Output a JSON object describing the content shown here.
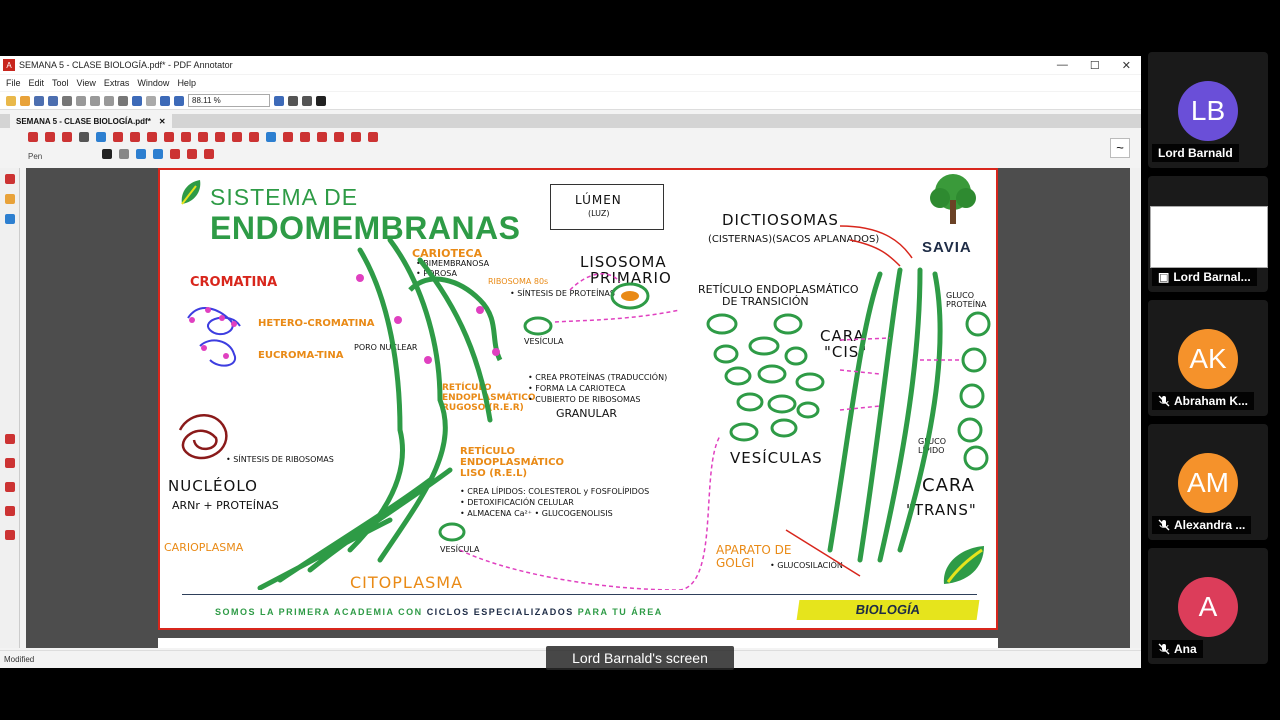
{
  "window": {
    "title": "SEMANA 5 - CLASE BIOLOGÍA.pdf* - PDF Annotator",
    "minimize": "—",
    "maximize": "☐",
    "close": "✕"
  },
  "menu": [
    "File",
    "Edit",
    "Tool",
    "View",
    "Extras",
    "Window",
    "Help"
  ],
  "zoom": "88.11 %",
  "tab": {
    "label": "SEMANA 5 - CLASE BIOLOGÍA.pdf*",
    "close": "✕"
  },
  "tool": {
    "name": "Pen"
  },
  "status": {
    "text": "Modified"
  },
  "share_label": "Lord Barnald's screen",
  "page": {
    "title_line1": "SISTEMA DE",
    "title_line2": "ENDOMEMBRANAS",
    "brand": "SAVIA",
    "footer_pre": "SOMOS LA PRIMERA ACADEMIA CON",
    "footer_bold": "CICLOS ESPECIALIZADOS",
    "footer_post": "PARA TU ÁREA",
    "subject": "BIOLOGÍA",
    "notes": {
      "lumen": "LÚMEN",
      "lumen_sub": "(LUZ)",
      "lisosoma": "LISOSOMA",
      "primario": "PRIMARIO",
      "dictiosomas": "DICTIOSOMAS",
      "cisternas": "(CISTERNAS)(SACOS APLANADOS)",
      "reticulo_transicion": "RETÍCULO ENDOPLASMÁTICO",
      "de_transicion": "DE TRANSICIÓN",
      "cara_cis": "CARA",
      "cis": "\"CIS\"",
      "cara_trans": "CARA",
      "trans": "\"TRANS\"",
      "vesiculas": "VESÍCULAS",
      "cromatina": "CROMATINA",
      "heterocromatina": "HETERO-CROMATINA",
      "eucromatina": "EUCROMA-TINA",
      "nucleolo": "NUCLÉOLO",
      "arn_proteinas": "ARNr + PROTEÍNAS",
      "carioplasma": "CARIOPLASMA",
      "citoplasma": "CITOPLASMA",
      "carioteca": "CARIOTECA",
      "bimembranosa": "• BIMEMBRANOSA",
      "porosa": "• POROSA",
      "rer_title": "RETÍCULO ENDOPLASMÁTICO RUGOSO (R.E.R)",
      "granular": "GRANULAR",
      "rer_1": "• CREA PROTEÍNAS (TRADUCCIÓN)",
      "rer_2": "• FORMA LA CARIOTECA",
      "rer_3": "• CUBIERTO DE RIBOSOMAS",
      "rel_title": "RETÍCULO ENDOPLASMÁTICO LISO (R.E.L)",
      "rel_1": "• CREA LÍPIDOS: COLESTEROL y FOSFOLÍPIDOS",
      "rel_2": "• DETOXIFICACIÓN CELULAR",
      "rel_3": "• ALMACENA Ca²⁺ • GLUCOGENOLISIS",
      "golgi": "APARATO DE GOLGI",
      "glucosilacion": "• GLUCOSILACIÓN",
      "vesicula": "VESÍCULA",
      "poro_nuclear": "PORO NUCLEAR",
      "ribosoma": "RIBOSOMA 80s",
      "sintesis": "• SÍNTESIS DE PROTEÍNAS",
      "glucoproteina": "GLUCO PROTEÍNA",
      "glucolipido": "GLUCO LÍPIDO",
      "sintesis_ribosomas": "• SÍNTESIS DE RIBOSOMAS"
    }
  },
  "participants": [
    {
      "initials": "LB",
      "name": "Lord Barnald",
      "color": "#6a4fd8",
      "muted": false
    },
    {
      "initials": "",
      "name": "Lord Barnal...",
      "color": "",
      "muted": false
    },
    {
      "initials": "AK",
      "name": "Abraham K...",
      "color": "#f5922b",
      "muted": true
    },
    {
      "initials": "AM",
      "name": "Alexandra ...",
      "color": "#f5922b",
      "muted": true
    },
    {
      "initials": "A",
      "name": "Ana",
      "color": "#dc3d5a",
      "muted": true
    }
  ]
}
